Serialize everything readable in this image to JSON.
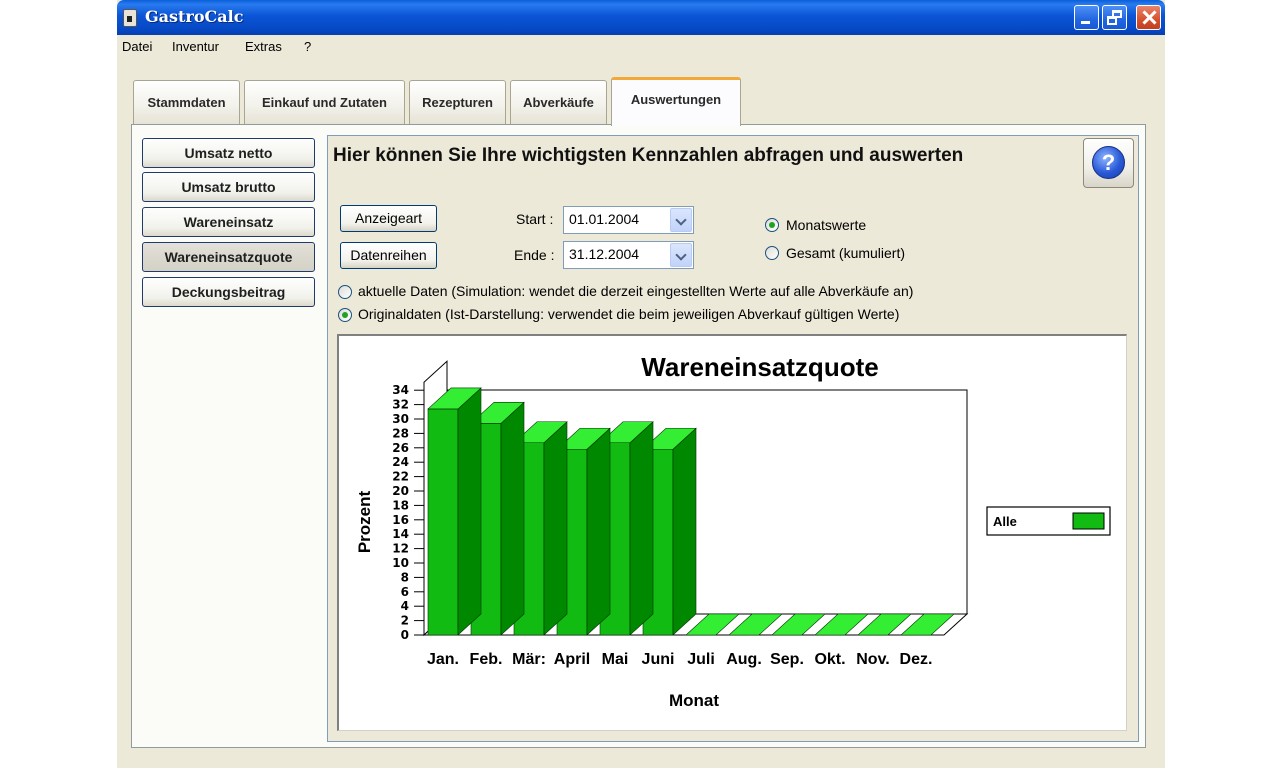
{
  "window": {
    "title": "GastroCalc"
  },
  "menu": [
    "Datei",
    "Inventur",
    "Extras",
    "?"
  ],
  "tabs": [
    "Stammdaten",
    "Einkauf und Zutaten",
    "Rezepturen",
    "Abverkäufe",
    "Auswertungen"
  ],
  "active_tab": "Auswertungen",
  "sidebar": {
    "items": [
      "Umsatz netto",
      "Umsatz brutto",
      "Wareneinsatz",
      "Wareneinsatzquote",
      "Deckungsbeitrag"
    ],
    "selected": "Wareneinsatzquote"
  },
  "main": {
    "heading": "Hier können Sie Ihre wichtigsten Kennzahlen abfragen und auswerten",
    "anzeigeart_button": "Anzeigeart",
    "datenreihen_button": "Datenreihen",
    "start_label": "Start :",
    "start_value": "01.01.2004",
    "end_label": "Ende :",
    "end_value": "31.12.2004",
    "radio_monthly": "Monatswerte",
    "radio_total": "Gesamt (kumuliert)",
    "radio_current_data": "aktuelle Daten (Simulation: wendet die derzeit eingestellten Werte auf alle Abverkäufe an)",
    "radio_original_data": "Originaldaten (Ist-Darstellung: verwendet die beim jeweiligen Abverkauf gültigen Werte)",
    "selected_period_mode": "Monatswerte",
    "selected_data_mode": "Originaldaten"
  },
  "colors": {
    "bar": "#11bb11",
    "bar_top": "#33ee33",
    "bar_side": "#008800",
    "tab_highlight": "#f3a93a"
  },
  "chart_data": {
    "type": "bar",
    "title": "Wareneinsatzquote",
    "xlabel": "Monat",
    "ylabel": "Prozent",
    "categories": [
      "Jan.",
      "Feb.",
      "Mär:",
      "April",
      "Mai",
      "Juni",
      "Juli",
      "Aug.",
      "Sep.",
      "Okt.",
      "Nov.",
      "Dez."
    ],
    "series": [
      {
        "name": "Alle",
        "values": [
          31.4,
          29.4,
          26.7,
          25.8,
          26.7,
          25.8,
          0,
          0,
          0,
          0,
          0,
          0
        ]
      }
    ],
    "y_ticks": [
      0,
      2,
      4,
      6,
      8,
      10,
      12,
      14,
      16,
      18,
      20,
      22,
      24,
      26,
      28,
      30,
      32,
      34
    ],
    "ylim": [
      0,
      34
    ],
    "three_d": true,
    "legend_position": "right"
  }
}
